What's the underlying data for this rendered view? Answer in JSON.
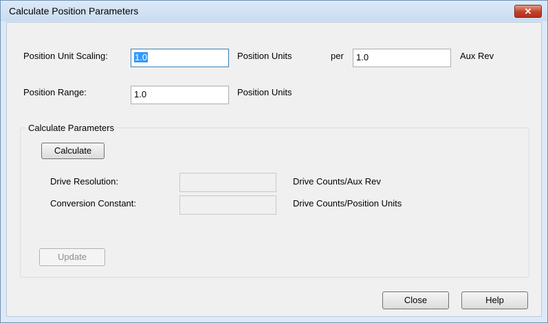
{
  "window": {
    "title": "Calculate Position Parameters",
    "close_glyph": "✕"
  },
  "scaling": {
    "label": "Position Unit Scaling:",
    "value": "1.0",
    "units_label": "Position Units",
    "per_label": "per",
    "aux_value": "1.0",
    "aux_units_label": "Aux Rev"
  },
  "range": {
    "label": "Position Range:",
    "value": "1.0",
    "units_label": "Position Units"
  },
  "calc_group": {
    "legend": "Calculate Parameters",
    "calculate_label": "Calculate",
    "drive_resolution_label": "Drive Resolution:",
    "drive_resolution_value": "",
    "drive_resolution_units": "Drive Counts/Aux Rev",
    "conversion_constant_label": "Conversion Constant:",
    "conversion_constant_value": "",
    "conversion_constant_units": "Drive Counts/Position Units",
    "update_label": "Update"
  },
  "footer": {
    "close_label": "Close",
    "help_label": "Help"
  }
}
